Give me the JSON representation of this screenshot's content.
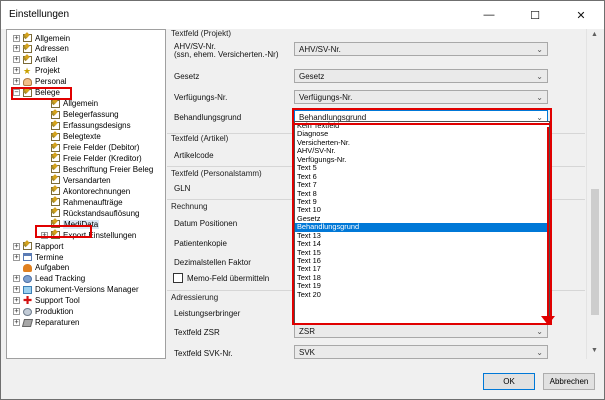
{
  "window": {
    "title": "Einstellungen",
    "minimize_glyph": "—",
    "maximize_glyph": "☐",
    "close_glyph": "✕"
  },
  "tree": {
    "items": [
      {
        "label": "Allgemein",
        "expander": "+",
        "icon": "doc-icon",
        "level": 0
      },
      {
        "label": "Adressen",
        "expander": "+",
        "icon": "doc-icon",
        "level": 0
      },
      {
        "label": "Artikel",
        "expander": "+",
        "icon": "doc-icon",
        "level": 0
      },
      {
        "label": "Projekt",
        "expander": "+",
        "icon": "star-icon",
        "level": 0
      },
      {
        "label": "Personal",
        "expander": "+",
        "icon": "person-icon",
        "level": 0
      },
      {
        "label": "Belege",
        "expander": "−",
        "icon": "doc-icon",
        "level": 0
      },
      {
        "label": "Allgemein",
        "expander": "",
        "icon": "doc-icon",
        "level": 1
      },
      {
        "label": "Belegerfassung",
        "expander": "",
        "icon": "doc-icon",
        "level": 1
      },
      {
        "label": "Erfassungsdesigns",
        "expander": "",
        "icon": "doc-icon",
        "level": 1
      },
      {
        "label": "Belegtexte",
        "expander": "",
        "icon": "doc-icon",
        "level": 1
      },
      {
        "label": "Freie Felder (Debitor)",
        "expander": "",
        "icon": "doc-icon",
        "level": 1
      },
      {
        "label": "Freie Felder (Kreditor)",
        "expander": "",
        "icon": "doc-icon",
        "level": 1
      },
      {
        "label": "Beschriftung Freier Beleg",
        "expander": "",
        "icon": "doc-icon",
        "level": 1
      },
      {
        "label": "Versandarten",
        "expander": "",
        "icon": "doc-icon",
        "level": 1
      },
      {
        "label": "Akontorechnungen",
        "expander": "",
        "icon": "doc-icon",
        "level": 1
      },
      {
        "label": "Rahmenaufträge",
        "expander": "",
        "icon": "doc-icon",
        "level": 1
      },
      {
        "label": "Rückstandsauflösung",
        "expander": "",
        "icon": "doc-icon",
        "level": 1
      },
      {
        "label": "MediData",
        "expander": "",
        "icon": "doc-icon",
        "level": 1
      },
      {
        "label": "Export Einstellungen",
        "expander": "+",
        "icon": "doc-icon",
        "level": 1
      },
      {
        "label": "Rapport",
        "expander": "+",
        "icon": "doc-icon",
        "level": 0
      },
      {
        "label": "Termine",
        "expander": "+",
        "icon": "calendar-icon",
        "level": 0
      },
      {
        "label": "Aufgaben",
        "expander": "",
        "icon": "flame-icon",
        "level": 0
      },
      {
        "label": "Lead Tracking",
        "expander": "+",
        "icon": "people-icon",
        "level": 0
      },
      {
        "label": "Dokument-Versions Manager",
        "expander": "+",
        "icon": "flow-icon",
        "level": 0
      },
      {
        "label": "Support Tool",
        "expander": "+",
        "icon": "red-plus-icon",
        "level": 0
      },
      {
        "label": "Produktion",
        "expander": "+",
        "icon": "gear-icon",
        "level": 0
      },
      {
        "label": "Reparaturen",
        "expander": "+",
        "icon": "tool-icon",
        "level": 0
      }
    ]
  },
  "form": {
    "projekt_title": "Textfeld (Projekt)",
    "ahv_label_line1": "AHV/SV-Nr.",
    "ahv_label_line2": "(ssn, ehem. Versicherten.-Nr)",
    "ahv_value": "AHV/SV-Nr.",
    "gesetz_label": "Gesetz",
    "gesetz_value": "Gesetz",
    "verfuegung_label": "Verfügungs-Nr.",
    "verfuegung_value": "Verfügungs-Nr.",
    "behandlung_label": "Behandlungsgrund",
    "behandlung_value": "Behandlungsgrund",
    "artikel_title": "Textfeld (Artikel)",
    "artikelcode_label": "Artikelcode",
    "personal_title": "Textfeld (Personalstamm)",
    "gln_label": "GLN",
    "rechnung_title": "Rechnung",
    "datum_label": "Datum Positionen",
    "patientenkopie_label": "Patientenkopie",
    "dezimal_label": "Dezimalstellen Faktor",
    "memo_label": "Memo-Feld übermitteln",
    "adressierung_title": "Adressierung",
    "leistung_label": "Leistungserbringer",
    "zsr_label": "Textfeld ZSR",
    "zsr_value": "ZSR",
    "svk_label": "Textfeld SVK-Nr.",
    "svk_value": "SVK"
  },
  "dropdown": {
    "items": [
      "Kein Textfeld",
      "Diagnose",
      "Versicherten-Nr.",
      "AHV/SV-Nr.",
      "Verfügungs-Nr.",
      "Text 5",
      "Text 6",
      "Text 7",
      "Text 8",
      "Text 9",
      "Text 10",
      "Gesetz",
      "Behandlungsgrund",
      "Text 13",
      "Text 14",
      "Text 15",
      "Text 16",
      "Text 17",
      "Text 18",
      "Text 19",
      "Text 20"
    ],
    "selected": "Behandlungsgrund"
  },
  "buttons": {
    "ok": "OK",
    "cancel": "Abbrechen"
  },
  "colors": {
    "highlight": "#e00000",
    "selection": "#0078d7"
  }
}
